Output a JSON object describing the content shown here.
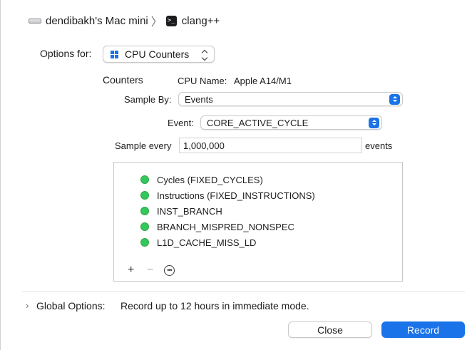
{
  "breadcrumb": {
    "device_icon": "mac-mini-icon",
    "device": "dendibakh's Mac mini",
    "separator_icon": "chevron-right-icon",
    "target_icon": "terminal-icon",
    "target": "clang++"
  },
  "options": {
    "label": "Options for:",
    "selected": "CPU Counters",
    "icon": "grid-icon"
  },
  "counters": {
    "heading": "Counters",
    "cpu_name_label": "CPU Name:",
    "cpu_name": "Apple A14/M1",
    "sample_by_label": "Sample By:",
    "sample_by": "Events",
    "event_label": "Event:",
    "event": "CORE_ACTIVE_CYCLE",
    "sample_every_label": "Sample every",
    "sample_every": "1,000,000",
    "sample_unit": "events",
    "items": [
      {
        "label": "Cycles (FIXED_CYCLES)",
        "status_color": "#34c759"
      },
      {
        "label": "Instructions (FIXED_INSTRUCTIONS)",
        "status_color": "#34c759"
      },
      {
        "label": "INST_BRANCH",
        "status_color": "#34c759"
      },
      {
        "label": "BRANCH_MISPRED_NONSPEC",
        "status_color": "#34c759"
      },
      {
        "label": "L1D_CACHE_MISS_LD",
        "status_color": "#34c759"
      }
    ],
    "toolbar": {
      "add": "+",
      "remove": "−",
      "more": "•••"
    }
  },
  "global": {
    "label": "Global Options:",
    "value": "Record up to 12 hours in immediate mode."
  },
  "buttons": {
    "close": "Close",
    "record": "Record"
  },
  "colors": {
    "accent": "#1a73e8",
    "status_ok": "#34c759"
  }
}
